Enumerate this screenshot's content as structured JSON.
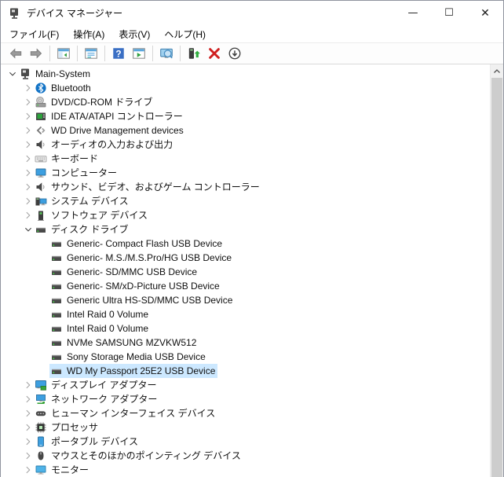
{
  "window": {
    "title": "デバイス マネージャー",
    "app_icon": "device-manager"
  },
  "caption": {
    "minimize_glyph": "—",
    "maximize_glyph": "☐",
    "close_glyph": "✕"
  },
  "menu": {
    "items": [
      {
        "label": "ファイル(F)"
      },
      {
        "label": "操作(A)"
      },
      {
        "label": "表示(V)"
      },
      {
        "label": "ヘルプ(H)"
      }
    ]
  },
  "toolbar": {
    "buttons": [
      {
        "type": "button",
        "icon": "back"
      },
      {
        "type": "button",
        "icon": "forward"
      },
      {
        "type": "separator"
      },
      {
        "type": "button",
        "icon": "console-tree"
      },
      {
        "type": "separator"
      },
      {
        "type": "button",
        "icon": "properties"
      },
      {
        "type": "separator"
      },
      {
        "type": "button",
        "icon": "help"
      },
      {
        "type": "button",
        "icon": "export-list"
      },
      {
        "type": "separator"
      },
      {
        "type": "button",
        "icon": "scan-hardware"
      },
      {
        "type": "separator"
      },
      {
        "type": "button",
        "icon": "update-driver"
      },
      {
        "type": "button",
        "icon": "uninstall"
      },
      {
        "type": "button",
        "icon": "disable-device"
      }
    ]
  },
  "tree": {
    "items": [
      {
        "level": 0,
        "label": "Main-System",
        "state": "expanded",
        "icon": "computer-system",
        "selected": false
      },
      {
        "level": 1,
        "label": "Bluetooth",
        "state": "collapsed",
        "icon": "bluetooth",
        "selected": false
      },
      {
        "level": 1,
        "label": "DVD/CD-ROM ドライブ",
        "state": "collapsed",
        "icon": "dvd-drive",
        "selected": false
      },
      {
        "level": 1,
        "label": "IDE ATA/ATAPI コントローラー",
        "state": "collapsed",
        "icon": "ide-controller",
        "selected": false
      },
      {
        "level": 1,
        "label": "WD Drive Management devices",
        "state": "collapsed",
        "icon": "wd-device",
        "selected": false
      },
      {
        "level": 1,
        "label": "オーディオの入力および出力",
        "state": "collapsed",
        "icon": "audio-io",
        "selected": false
      },
      {
        "level": 1,
        "label": "キーボード",
        "state": "collapsed",
        "icon": "keyboard",
        "selected": false
      },
      {
        "level": 1,
        "label": "コンピューター",
        "state": "collapsed",
        "icon": "computer",
        "selected": false
      },
      {
        "level": 1,
        "label": "サウンド、ビデオ、およびゲーム コントローラー",
        "state": "collapsed",
        "icon": "sound",
        "selected": false
      },
      {
        "level": 1,
        "label": "システム デバイス",
        "state": "collapsed",
        "icon": "system-devices",
        "selected": false
      },
      {
        "level": 1,
        "label": "ソフトウェア デバイス",
        "state": "collapsed",
        "icon": "software-devices",
        "selected": false
      },
      {
        "level": 1,
        "label": "ディスク ドライブ",
        "state": "expanded",
        "icon": "disk-drive",
        "selected": false
      },
      {
        "level": 2,
        "label": "Generic- Compact Flash USB Device",
        "state": "leaf",
        "icon": "disk-drive",
        "selected": false
      },
      {
        "level": 2,
        "label": "Generic- M.S./M.S.Pro/HG USB Device",
        "state": "leaf",
        "icon": "disk-drive",
        "selected": false
      },
      {
        "level": 2,
        "label": "Generic- SD/MMC USB Device",
        "state": "leaf",
        "icon": "disk-drive",
        "selected": false
      },
      {
        "level": 2,
        "label": "Generic- SM/xD-Picture USB Device",
        "state": "leaf",
        "icon": "disk-drive",
        "selected": false
      },
      {
        "level": 2,
        "label": "Generic Ultra HS-SD/MMC USB Device",
        "state": "leaf",
        "icon": "disk-drive",
        "selected": false
      },
      {
        "level": 2,
        "label": "Intel Raid 0 Volume",
        "state": "leaf",
        "icon": "disk-drive",
        "selected": false
      },
      {
        "level": 2,
        "label": "Intel Raid 0 Volume",
        "state": "leaf",
        "icon": "disk-drive",
        "selected": false
      },
      {
        "level": 2,
        "label": "NVMe SAMSUNG MZVKW512",
        "state": "leaf",
        "icon": "disk-drive",
        "selected": false
      },
      {
        "level": 2,
        "label": "Sony Storage Media USB Device",
        "state": "leaf",
        "icon": "disk-drive",
        "selected": false
      },
      {
        "level": 2,
        "label": "WD My Passport 25E2 USB Device",
        "state": "leaf",
        "icon": "disk-drive",
        "selected": true
      },
      {
        "level": 1,
        "label": "ディスプレイ アダプター",
        "state": "collapsed",
        "icon": "display-adapter",
        "selected": false
      },
      {
        "level": 1,
        "label": "ネットワーク アダプター",
        "state": "collapsed",
        "icon": "network-adapter",
        "selected": false
      },
      {
        "level": 1,
        "label": "ヒューマン インターフェイス デバイス",
        "state": "collapsed",
        "icon": "hid",
        "selected": false
      },
      {
        "level": 1,
        "label": "プロセッサ",
        "state": "collapsed",
        "icon": "processor",
        "selected": false
      },
      {
        "level": 1,
        "label": "ポータブル デバイス",
        "state": "collapsed",
        "icon": "portable-device",
        "selected": false
      },
      {
        "level": 1,
        "label": "マウスとそのほかのポインティング デバイス",
        "state": "collapsed",
        "icon": "mouse",
        "selected": false
      },
      {
        "level": 1,
        "label": "モニター",
        "state": "collapsed",
        "icon": "monitor",
        "selected": false
      }
    ]
  },
  "scrollbar": {
    "up_icon": "chevron-up"
  },
  "colors": {
    "selection_background": "#cce8ff",
    "help_icon_blue": "#3a6fc4",
    "uninstall_red": "#cf1f1f",
    "device_green": "#3aa43a",
    "monitor_blue": "#3d9fe0"
  }
}
